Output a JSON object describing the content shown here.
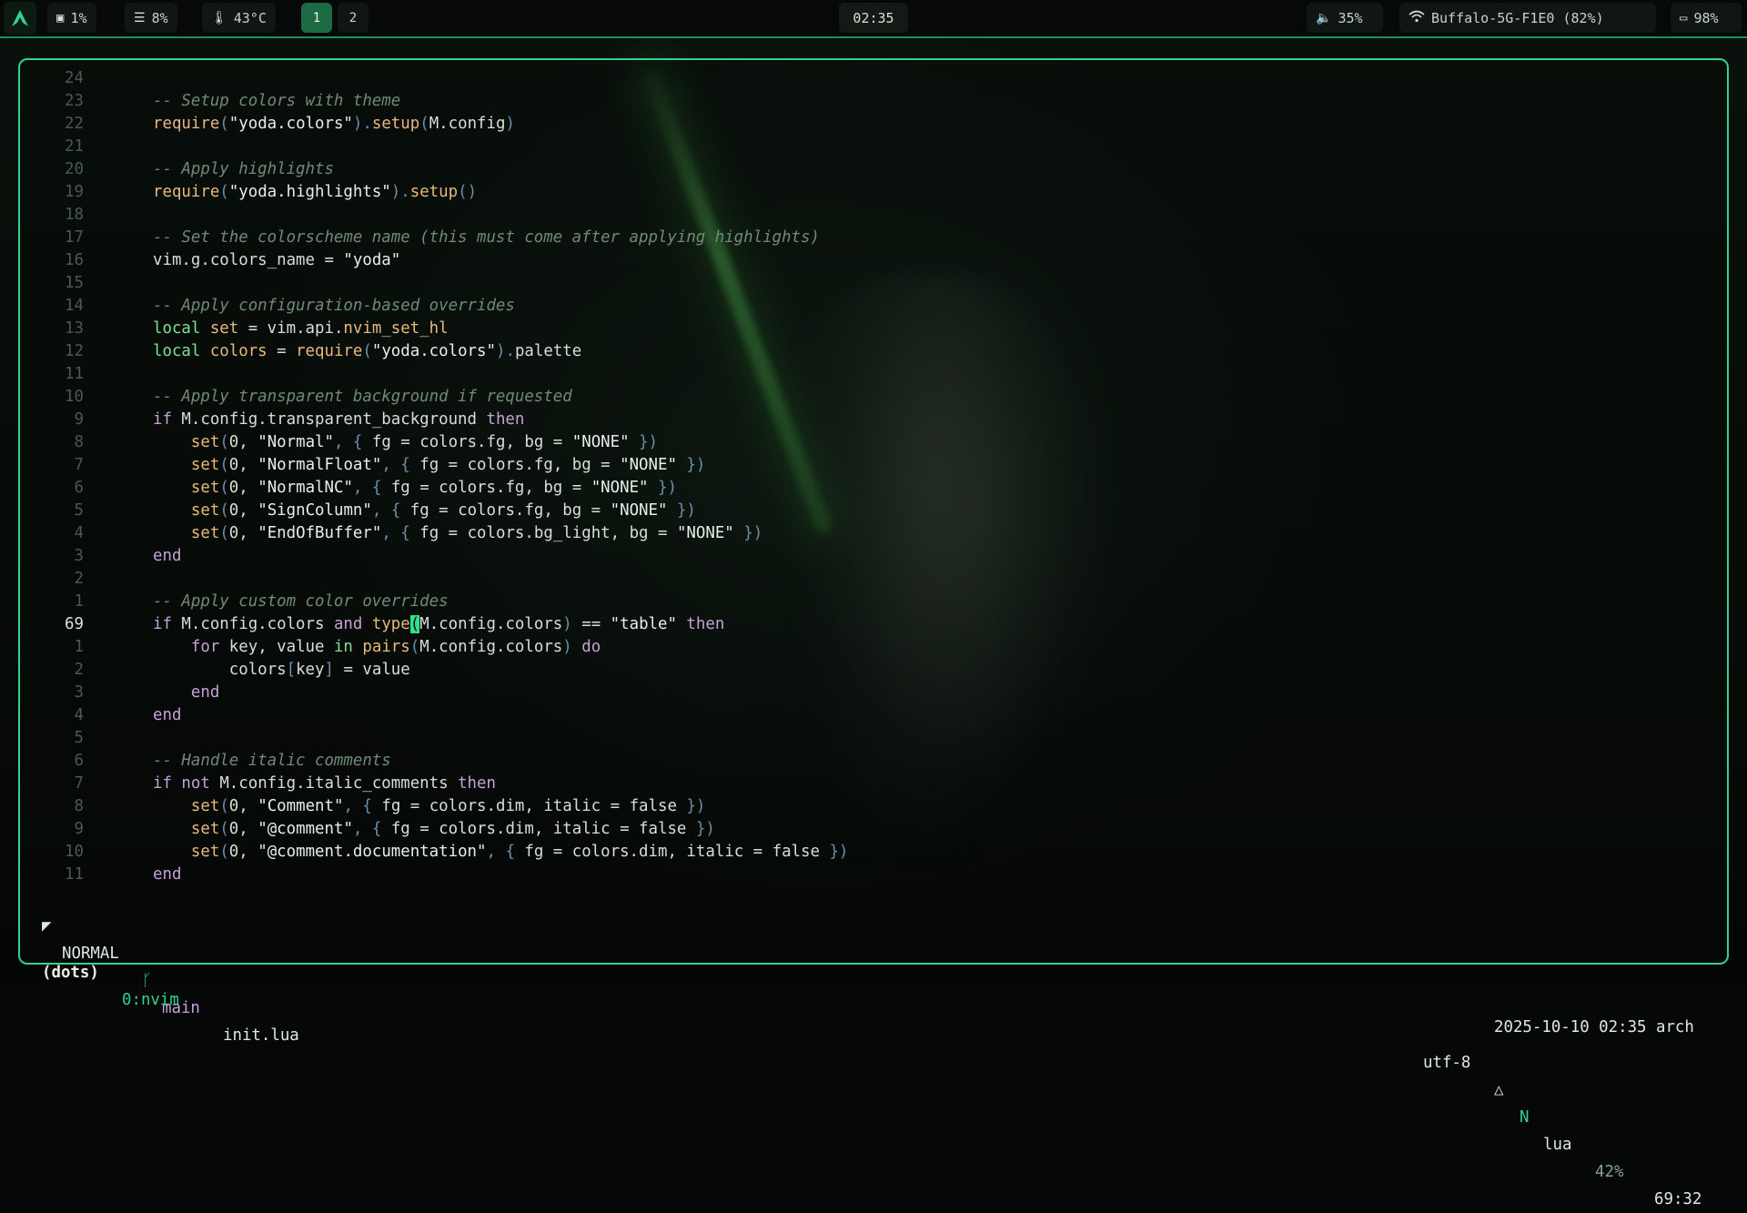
{
  "topbar": {
    "cpu": "1%",
    "memory": "8%",
    "temperature": "43°C",
    "workspaces": [
      "1",
      "2"
    ],
    "active_workspace": "1",
    "clock": "02:35",
    "volume": "35%",
    "wifi": "Buffalo-5G-F1E0 (82%)",
    "battery": "98%",
    "icons": {
      "logo": "arch-logo-icon",
      "cpu": "cpu-icon",
      "memory": "memory-icon",
      "temperature": "thermometer-icon",
      "volume": "speaker-icon",
      "wifi": "wifi-icon",
      "battery": "battery-icon"
    }
  },
  "editor": {
    "lines": [
      {
        "n": "24",
        "code": [],
        "current": false
      },
      {
        "n": "23",
        "code": [
          [
            "cm",
            "-- Setup colors with theme"
          ]
        ],
        "current": false
      },
      {
        "n": "22",
        "code": [
          [
            "fn",
            "require"
          ],
          [
            "pu",
            "("
          ],
          [
            "st",
            "\"yoda.colors\""
          ],
          [
            "pu",
            ")."
          ],
          [
            "fn",
            "setup"
          ],
          [
            "pu",
            "("
          ],
          [
            "id",
            "M.config"
          ],
          [
            "pu",
            ")"
          ]
        ],
        "current": false
      },
      {
        "n": "21",
        "code": [],
        "current": false
      },
      {
        "n": "20",
        "code": [
          [
            "cm",
            "-- Apply highlights"
          ]
        ],
        "current": false
      },
      {
        "n": "19",
        "code": [
          [
            "fn",
            "require"
          ],
          [
            "pu",
            "("
          ],
          [
            "st",
            "\"yoda.highlights\""
          ],
          [
            "pu",
            ")."
          ],
          [
            "fn",
            "setup"
          ],
          [
            "pu",
            "()"
          ]
        ],
        "current": false
      },
      {
        "n": "18",
        "code": [],
        "current": false
      },
      {
        "n": "17",
        "code": [
          [
            "cm",
            "-- Set the colorscheme name (this must come after applying highlights)"
          ]
        ],
        "current": false
      },
      {
        "n": "16",
        "code": [
          [
            "id",
            "vim.g.colors_name = "
          ],
          [
            "st",
            "\"yoda\""
          ]
        ],
        "current": false
      },
      {
        "n": "15",
        "code": [],
        "current": false
      },
      {
        "n": "14",
        "code": [
          [
            "cm",
            "-- Apply configuration-based overrides"
          ]
        ],
        "current": false
      },
      {
        "n": "13",
        "code": [
          [
            "gr",
            "local "
          ],
          [
            "fn",
            "set"
          ],
          [
            "id",
            " = vim.api."
          ],
          [
            "fn",
            "nvim_set_hl"
          ]
        ],
        "current": false
      },
      {
        "n": "12",
        "code": [
          [
            "gr",
            "local "
          ],
          [
            "fn",
            "colors"
          ],
          [
            "id",
            " = "
          ],
          [
            "fn",
            "require"
          ],
          [
            "pu",
            "("
          ],
          [
            "st",
            "\"yoda.colors\""
          ],
          [
            "pu",
            ")."
          ],
          [
            "id",
            "palette"
          ]
        ],
        "current": false
      },
      {
        "n": "11",
        "code": [],
        "current": false
      },
      {
        "n": "10",
        "code": [
          [
            "cm",
            "-- Apply transparent background if requested"
          ]
        ],
        "current": false
      },
      {
        "n": "9",
        "code": [
          [
            "kw",
            "if "
          ],
          [
            "id",
            "M.config.transparent_background "
          ],
          [
            "kw",
            "then"
          ]
        ],
        "current": false
      },
      {
        "n": "8",
        "code": [
          [
            "id",
            "    "
          ],
          [
            "fn",
            "set"
          ],
          [
            "pu",
            "("
          ],
          [
            "id",
            "0, "
          ],
          [
            "st",
            "\"Normal\""
          ],
          [
            "pu",
            ", { "
          ],
          [
            "id",
            "fg = colors.fg, bg = "
          ],
          [
            "st",
            "\"NONE\""
          ],
          [
            "pu",
            " })"
          ]
        ],
        "current": false
      },
      {
        "n": "7",
        "code": [
          [
            "id",
            "    "
          ],
          [
            "fn",
            "set"
          ],
          [
            "pu",
            "("
          ],
          [
            "id",
            "0, "
          ],
          [
            "st",
            "\"NormalFloat\""
          ],
          [
            "pu",
            ", { "
          ],
          [
            "id",
            "fg = colors.fg, bg = "
          ],
          [
            "st",
            "\"NONE\""
          ],
          [
            "pu",
            " })"
          ]
        ],
        "current": false
      },
      {
        "n": "6",
        "code": [
          [
            "id",
            "    "
          ],
          [
            "fn",
            "set"
          ],
          [
            "pu",
            "("
          ],
          [
            "id",
            "0, "
          ],
          [
            "st",
            "\"NormalNC\""
          ],
          [
            "pu",
            ", { "
          ],
          [
            "id",
            "fg = colors.fg, bg = "
          ],
          [
            "st",
            "\"NONE\""
          ],
          [
            "pu",
            " })"
          ]
        ],
        "current": false
      },
      {
        "n": "5",
        "code": [
          [
            "id",
            "    "
          ],
          [
            "fn",
            "set"
          ],
          [
            "pu",
            "("
          ],
          [
            "id",
            "0, "
          ],
          [
            "st",
            "\"SignColumn\""
          ],
          [
            "pu",
            ", { "
          ],
          [
            "id",
            "fg = colors.fg, bg = "
          ],
          [
            "st",
            "\"NONE\""
          ],
          [
            "pu",
            " })"
          ]
        ],
        "current": false
      },
      {
        "n": "4",
        "code": [
          [
            "id",
            "    "
          ],
          [
            "fn",
            "set"
          ],
          [
            "pu",
            "("
          ],
          [
            "id",
            "0, "
          ],
          [
            "st",
            "\"EndOfBuffer\""
          ],
          [
            "pu",
            ", { "
          ],
          [
            "id",
            "fg = colors.bg_light, bg = "
          ],
          [
            "st",
            "\"NONE\""
          ],
          [
            "pu",
            " })"
          ]
        ],
        "current": false
      },
      {
        "n": "3",
        "code": [
          [
            "kw",
            "end"
          ]
        ],
        "current": false
      },
      {
        "n": "2",
        "code": [],
        "current": false
      },
      {
        "n": "1",
        "code": [
          [
            "cm",
            "-- Apply custom color overrides"
          ]
        ],
        "current": false
      },
      {
        "n": "69",
        "code": [
          [
            "kw",
            "if "
          ],
          [
            "id",
            "M.config.colors "
          ],
          [
            "kw",
            "and "
          ],
          [
            "fn",
            "type"
          ],
          [
            "cursor",
            "("
          ],
          [
            "id",
            "M.config.colors"
          ],
          [
            "pu",
            ")"
          ],
          [
            "id",
            " == "
          ],
          [
            "st",
            "\"table\""
          ],
          [
            "kw",
            " then"
          ]
        ],
        "current": true
      },
      {
        "n": "1",
        "code": [
          [
            "id",
            "    "
          ],
          [
            "kw",
            "for "
          ],
          [
            "id",
            "key, value "
          ],
          [
            "gr",
            "in "
          ],
          [
            "fn",
            "pairs"
          ],
          [
            "pu",
            "("
          ],
          [
            "id",
            "M.config.colors"
          ],
          [
            "pu",
            ")"
          ],
          [
            "kw",
            " do"
          ]
        ],
        "current": false
      },
      {
        "n": "2",
        "code": [
          [
            "id",
            "        colors"
          ],
          [
            "pu",
            "["
          ],
          [
            "id",
            "key"
          ],
          [
            "pu",
            "]"
          ],
          [
            "id",
            " = value"
          ]
        ],
        "current": false
      },
      {
        "n": "3",
        "code": [
          [
            "id",
            "    "
          ],
          [
            "kw",
            "end"
          ]
        ],
        "current": false
      },
      {
        "n": "4",
        "code": [
          [
            "kw",
            "end"
          ]
        ],
        "current": false
      },
      {
        "n": "5",
        "code": [],
        "current": false
      },
      {
        "n": "6",
        "code": [
          [
            "cm",
            "-- Handle italic comments"
          ]
        ],
        "current": false
      },
      {
        "n": "7",
        "code": [
          [
            "kw",
            "if "
          ],
          [
            "kw",
            "not "
          ],
          [
            "id",
            "M.config.italic_comments "
          ],
          [
            "kw",
            "then"
          ]
        ],
        "current": false
      },
      {
        "n": "8",
        "code": [
          [
            "id",
            "    "
          ],
          [
            "fn",
            "set"
          ],
          [
            "pu",
            "("
          ],
          [
            "id",
            "0, "
          ],
          [
            "st",
            "\"Comment\""
          ],
          [
            "pu",
            ", { "
          ],
          [
            "id",
            "fg = colors.dim, italic = false "
          ],
          [
            "pu",
            "})"
          ]
        ],
        "current": false
      },
      {
        "n": "9",
        "code": [
          [
            "id",
            "    "
          ],
          [
            "fn",
            "set"
          ],
          [
            "pu",
            "("
          ],
          [
            "id",
            "0, "
          ],
          [
            "st",
            "\"@comment\""
          ],
          [
            "pu",
            ", { "
          ],
          [
            "id",
            "fg = colors.dim, italic = false "
          ],
          [
            "pu",
            "})"
          ]
        ],
        "current": false
      },
      {
        "n": "10",
        "code": [
          [
            "id",
            "    "
          ],
          [
            "fn",
            "set"
          ],
          [
            "pu",
            "("
          ],
          [
            "id",
            "0, "
          ],
          [
            "st",
            "\"@comment.documentation\""
          ],
          [
            "pu",
            ", { "
          ],
          [
            "id",
            "fg = colors.dim, italic = false "
          ],
          [
            "pu",
            "})"
          ]
        ],
        "current": false
      },
      {
        "n": "11",
        "code": [
          [
            "kw",
            "end"
          ]
        ],
        "current": false
      }
    ]
  },
  "statusline": {
    "mode": "NORMAL",
    "branch": "main",
    "file": "init.lua",
    "encoding": "utf-8",
    "filetype": "lua",
    "percent": "42%",
    "position": "69:32"
  },
  "tmux": {
    "session": "(dots)",
    "window": "0:nvim",
    "datetime": "2025-10-10 02:35 arch"
  },
  "colors": {
    "accent": "#2fd38f",
    "comment": "#6f8a78",
    "keyword": "#c6a1d8",
    "function": "#e8b97a",
    "local": "#7fe08f"
  }
}
